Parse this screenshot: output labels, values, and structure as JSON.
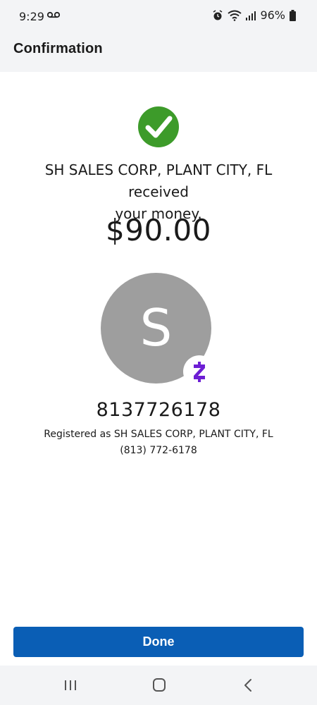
{
  "status_bar": {
    "time": "9:29",
    "battery": "96%",
    "icons": [
      "voicemail-icon",
      "alarm-icon",
      "wifi-icon",
      "signal-icon",
      "battery-icon"
    ]
  },
  "header": {
    "title": "Confirmation"
  },
  "confirmation": {
    "icon": "check-circle-icon",
    "message_line1": "SH SALES CORP, PLANT CITY, FL received",
    "message_line2": "your money.",
    "amount": "$90.00",
    "avatar_initial": "S",
    "badge_icon": "zelle-logo-icon",
    "recipient_number": "8137726178",
    "registered_as": "Registered as SH SALES CORP, PLANT CITY, FL",
    "phone": "(813) 772-6178"
  },
  "actions": {
    "done_label": "Done"
  },
  "navigation": {
    "icons": [
      "recent-apps-icon",
      "home-icon",
      "back-icon"
    ]
  },
  "colors": {
    "success_green": "#3d9b2a",
    "primary_blue": "#0a5eb5",
    "zelle_purple": "#6d1ed4",
    "avatar_gray": "#9e9e9e"
  }
}
